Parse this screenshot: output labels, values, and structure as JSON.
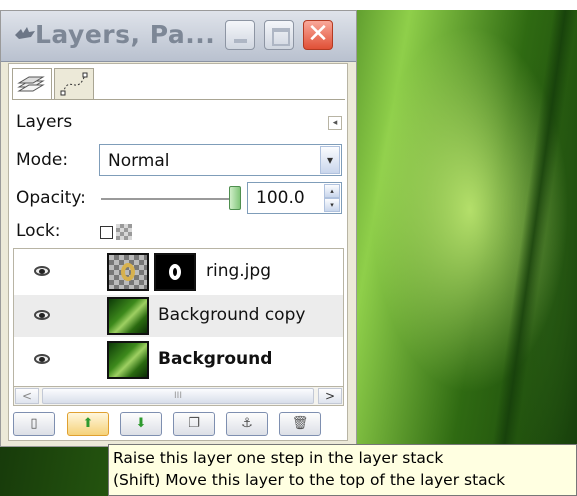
{
  "window": {
    "title": "Layers, Pa...",
    "minimize_icon": "minimize-icon",
    "maximize_icon": "maximize-icon",
    "close_icon": "close-icon",
    "close_glyph": "✕"
  },
  "tabs": [
    {
      "name": "layers-tab",
      "icon": "layers-stack-icon",
      "active": true
    },
    {
      "name": "paths-tab",
      "icon": "paths-icon",
      "active": false
    }
  ],
  "panel": {
    "title": "Layers",
    "menu_glyph": "◂"
  },
  "mode": {
    "label": "Mode:",
    "value": "Normal",
    "dropdown_glyph": "▾"
  },
  "opacity": {
    "label": "Opacity:",
    "value": "100.0",
    "percent": 100,
    "up_glyph": "▴",
    "down_glyph": "▾"
  },
  "lock": {
    "label": "Lock:",
    "checked": false
  },
  "layers": [
    {
      "name": "ring.jpg",
      "visible": true,
      "bold": false,
      "selected": false,
      "has_mask": true
    },
    {
      "name": "Background copy",
      "visible": true,
      "bold": false,
      "selected": true,
      "has_mask": false
    },
    {
      "name": "Background",
      "visible": true,
      "bold": true,
      "selected": false,
      "has_mask": false
    }
  ],
  "scrollbar": {
    "left_glyph": "<",
    "right_glyph": ">",
    "grip_glyph": "III"
  },
  "toolbar_buttons": [
    {
      "name": "new-layer-button",
      "icon": "new-layer-icon",
      "glyph": "▯"
    },
    {
      "name": "raise-layer-button",
      "icon": "arrow-up-icon",
      "glyph": "⬆"
    },
    {
      "name": "lower-layer-button",
      "icon": "arrow-down-icon",
      "glyph": "⬇"
    },
    {
      "name": "duplicate-layer-button",
      "icon": "duplicate-icon",
      "glyph": "❐"
    },
    {
      "name": "anchor-layer-button",
      "icon": "anchor-icon",
      "glyph": "⚓"
    },
    {
      "name": "delete-layer-button",
      "icon": "trash-icon",
      "glyph": "🗑"
    }
  ],
  "tooltip": {
    "line1": "Raise this layer one step in the layer stack",
    "line2": "(Shift)  Move this layer to the top of the layer stack"
  },
  "colors": {
    "tooltip_bg": "#ffffe1",
    "close_button": "#e05036",
    "selected_row": "#ececec",
    "hot_button": "#f5d27a"
  }
}
